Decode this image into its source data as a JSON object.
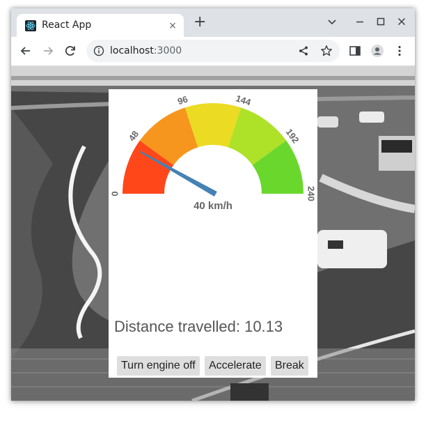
{
  "browser": {
    "tab_title": "React App",
    "tab_close": "×",
    "new_tab": "+",
    "url_host": "localhost",
    "url_port": ":3000"
  },
  "speedometer": {
    "min": 0,
    "max": 240,
    "current_value": 40,
    "unit": "km/h",
    "current_text": "40 km/h",
    "tick_labels": [
      "0",
      "48",
      "96",
      "144",
      "192",
      "240"
    ],
    "segment_colors": [
      "#ff471a",
      "#f6961e",
      "#ecdb23",
      "#aee228",
      "#6ad72d"
    ],
    "needle_color": "#4682b4"
  },
  "distance": {
    "text": "Distance travelled: 10.13"
  },
  "buttons": {
    "engine_label": "Turn engine off",
    "accelerate_label": "Accelerate",
    "break_label": "Break"
  }
}
